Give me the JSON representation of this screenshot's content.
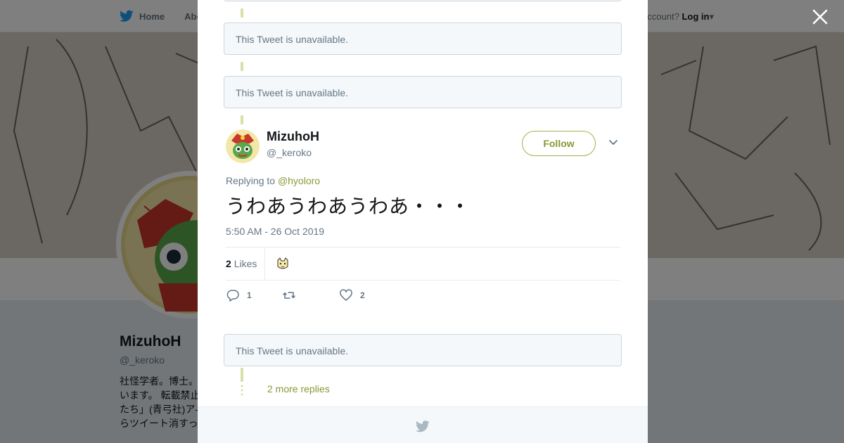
{
  "background": {
    "nav": {
      "home_label": "Home",
      "about_label": "Abo"
    },
    "login": {
      "prompt": "ccount?",
      "login_label": "Log in"
    },
    "profile": {
      "name": "MizuhoH",
      "handle": "@_keroko",
      "bio_lines": [
        "社怪学者。博士。",
        "います。 転載禁止",
        "たち」(青弓社)ア-",
        "らツイート消すっ"
      ]
    }
  },
  "modal": {
    "unavailable_text": "This Tweet is unavailable.",
    "tweet": {
      "user_name": "MizuhoH",
      "user_handle": "@_keroko",
      "follow_label": "Follow",
      "replying_prefix": "Replying to",
      "replying_to": "@hyoloro",
      "text": "うわあうわあうわあ・・・",
      "timestamp": "5:50 AM - 26 Oct 2019",
      "likes_count": "2",
      "likes_label": "Likes",
      "reply_count": "1",
      "retweet_count": "",
      "like_count": "2"
    },
    "more_replies_label": "2 more replies"
  },
  "colors": {
    "accent": "#8a9733",
    "thread_line": "#d9dfa9",
    "unavailable_bg": "#f5f8fa"
  },
  "icons": [
    "twitter-bird-icon",
    "close-icon",
    "chevron-down-icon",
    "reply-icon",
    "retweet-icon",
    "heart-icon"
  ]
}
